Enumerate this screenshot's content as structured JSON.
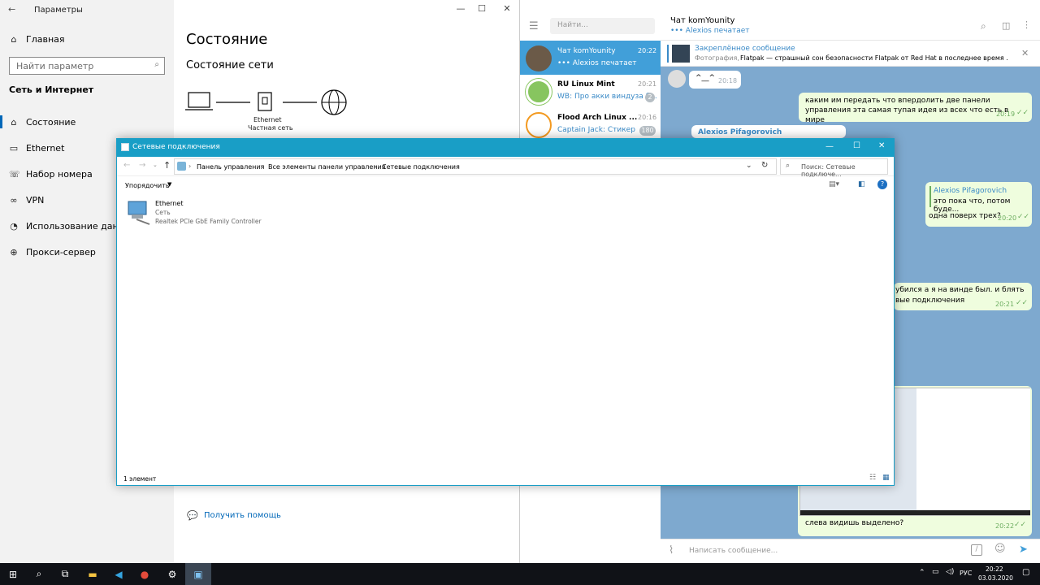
{
  "settings": {
    "title": "Параметры",
    "home": "Главная",
    "search_placeholder": "Найти параметр",
    "section": "Сеть и Интернет",
    "nav": [
      {
        "label": "Состояние",
        "icon": "status-icon",
        "active": true
      },
      {
        "label": "Ethernet",
        "icon": "ethernet-icon"
      },
      {
        "label": "Набор номера",
        "icon": "dialup-icon"
      },
      {
        "label": "VPN",
        "icon": "vpn-icon"
      },
      {
        "label": "Использование данных",
        "icon": "data-usage-icon"
      },
      {
        "label": "Прокси-сервер",
        "icon": "proxy-icon"
      }
    ],
    "page_title": "Состояние",
    "subtitle": "Состояние сети",
    "net_name": "Ethernet",
    "net_type": "Частная сеть",
    "help_link": "Получить помощь"
  },
  "telegram": {
    "search_placeholder": "Найти...",
    "chats": [
      {
        "name": "Чат komYounity",
        "preview": "••• Alexios печатает",
        "time": "20:22",
        "badge": ""
      },
      {
        "name": "RU Linux Mint",
        "preview": "WB: Про акки виндуза б...",
        "time": "20:21",
        "badge": "2"
      },
      {
        "name": "Flood Arch Linux ...",
        "preview": "Captain Jack: Стикер",
        "time": "20:16",
        "badge": "180"
      }
    ],
    "header_title": "Чат komYounity",
    "header_status": "••• Alexios печатает",
    "pinned_label": "Закреплённое сообщение",
    "pinned_prefix": "Фотография,",
    "pinned_text": "Flatpak — страшный сон безопасности  Flatpak от Red Hat в последнее время ...",
    "messages": {
      "m1_text": "^__^",
      "m1_time": "20:18",
      "m2_text": "каким им передать что впердолить две панели управления эта самая тупая идея из всех что есть в мире",
      "m2_time": "20:19",
      "m3_author": "Alexios Pifagorovich",
      "m4_quote_author": "Alexios Pifagorovich",
      "m4_quote_text": "это пока что, потом буде...",
      "m4_text": "одна поверх трех?",
      "m4_time": "20:20",
      "m5_text_a": "убился а я на винде был. и  блять",
      "m5_text_b": "вые подключения",
      "m5_time": "20:21",
      "m6_text": "слева видишь выделено?",
      "m6_time": "20:22"
    },
    "compose_placeholder": "Написать сообщение..."
  },
  "explorer": {
    "title": "Сетевые подключения",
    "breadcrumb": [
      "Панель управления",
      "Все элементы панели управления",
      "Сетевые подключения"
    ],
    "search_placeholder": "Поиск: Сетевые подключе...",
    "organize": "Упорядочить",
    "items": [
      {
        "name": "Ethernet",
        "status": "Сеть",
        "device": "Realtek PCIe GbE Family Controller"
      }
    ],
    "status_count": "1 элемент"
  },
  "taskbar": {
    "lang": "РУС",
    "time": "20:22",
    "date": "03.03.2020"
  },
  "colors": {
    "accent": "#0067b8",
    "explorer_title": "#199ec6",
    "telegram_selected": "#419fd9",
    "telegram_bg": "#7ea9cf",
    "taskbar": "#101217"
  }
}
